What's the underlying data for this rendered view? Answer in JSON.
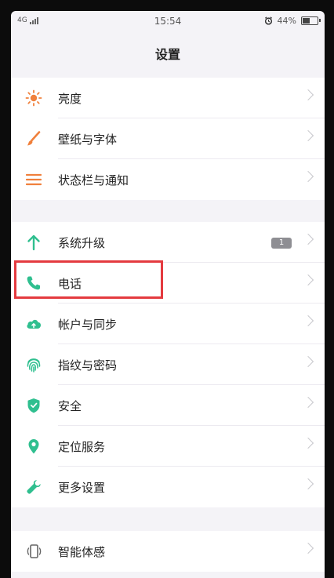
{
  "status_bar": {
    "network": "4G",
    "time": "15:54",
    "battery": "44%",
    "battery_level": 0.44
  },
  "header": {
    "title": "设置"
  },
  "groups": [
    {
      "items": [
        {
          "label": "亮度",
          "icon": "sun-icon"
        },
        {
          "label": "壁纸与字体",
          "icon": "brush-icon"
        },
        {
          "label": "状态栏与通知",
          "icon": "list-icon"
        }
      ]
    },
    {
      "items": [
        {
          "label": "系统升级",
          "icon": "arrow-up-icon",
          "badge": "1"
        },
        {
          "label": "电话",
          "icon": "phone-icon"
        },
        {
          "label": "帐户与同步",
          "icon": "cloud-icon"
        },
        {
          "label": "指纹与密码",
          "icon": "fingerprint-icon"
        },
        {
          "label": "安全",
          "icon": "shield-icon"
        },
        {
          "label": "定位服务",
          "icon": "location-pin-icon"
        },
        {
          "label": "更多设置",
          "icon": "wrench-icon"
        }
      ]
    },
    {
      "items": [
        {
          "label": "智能体感",
          "icon": "phone-gesture-icon"
        }
      ]
    }
  ],
  "colors": {
    "orange": "#f0803c",
    "green": "#2fbf8f",
    "highlight": "#e43a3f",
    "background": "#f4f3f7"
  }
}
